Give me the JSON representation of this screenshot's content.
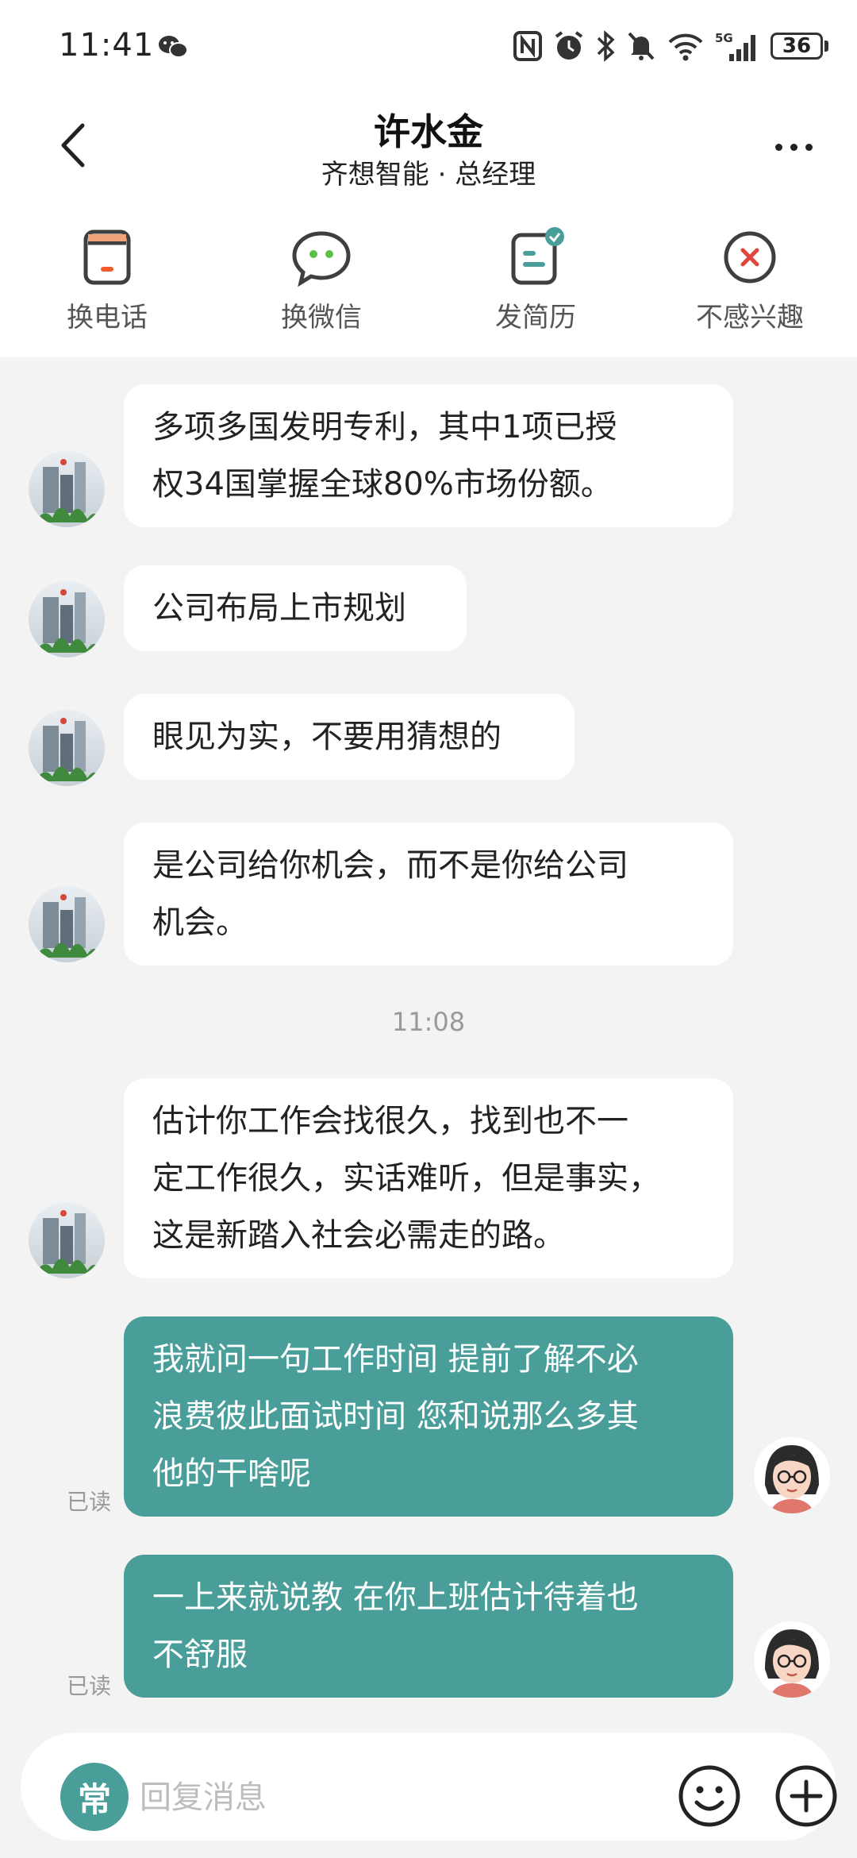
{
  "status_bar": {
    "time": "11:41",
    "network": "5G",
    "battery": "36",
    "icons": [
      "wechat-icon",
      "nfc-icon",
      "alarm-icon",
      "bluetooth-icon",
      "mute-icon",
      "wifi-icon",
      "signal-icon",
      "battery-icon"
    ]
  },
  "header": {
    "name": "许水金",
    "subtitle": "齐想智能 · 总经理"
  },
  "actions": [
    {
      "label": "换电话",
      "icon": "phone-card-icon"
    },
    {
      "label": "换微信",
      "icon": "wechat-bubble-icon"
    },
    {
      "label": "发简历",
      "icon": "resume-icon"
    },
    {
      "label": "不感兴趣",
      "icon": "not-interested-icon"
    }
  ],
  "messages": [
    {
      "from": "contact",
      "text_lines": [
        "多项多国发明专利，其中1项已授",
        "权34国掌握全球80%市场份额。"
      ]
    },
    {
      "from": "contact",
      "text_lines": [
        "公司布局上市规划"
      ]
    },
    {
      "from": "contact",
      "text_lines": [
        "眼见为实，不要用猜想的"
      ]
    },
    {
      "from": "contact",
      "text_lines": [
        "是公司给你机会，而不是你给公司",
        "机会。"
      ]
    },
    {
      "from": "contact",
      "text_lines": [
        "估计你工作会找很久，找到也不一",
        "定工作很久，实话难听，但是事实，",
        "这是新踏入社会必需走的路。"
      ]
    },
    {
      "from": "me",
      "read": "已读",
      "text_lines": [
        "我就问一句工作时间 提前了解不必",
        "浪费彼此面试时间 您和说那么多其",
        "他的干啥呢"
      ]
    },
    {
      "from": "me",
      "read": "已读",
      "text_lines": [
        "一上来就说教 在你上班估计待着也",
        "不舒服"
      ]
    }
  ],
  "timestamp": "11:08",
  "input": {
    "common_label": "常",
    "placeholder": "回复消息"
  },
  "colors": {
    "accent": "#4a9e9a",
    "background": "#f3f3f3",
    "bubble": "#ffffff",
    "danger": "#e0463f"
  }
}
